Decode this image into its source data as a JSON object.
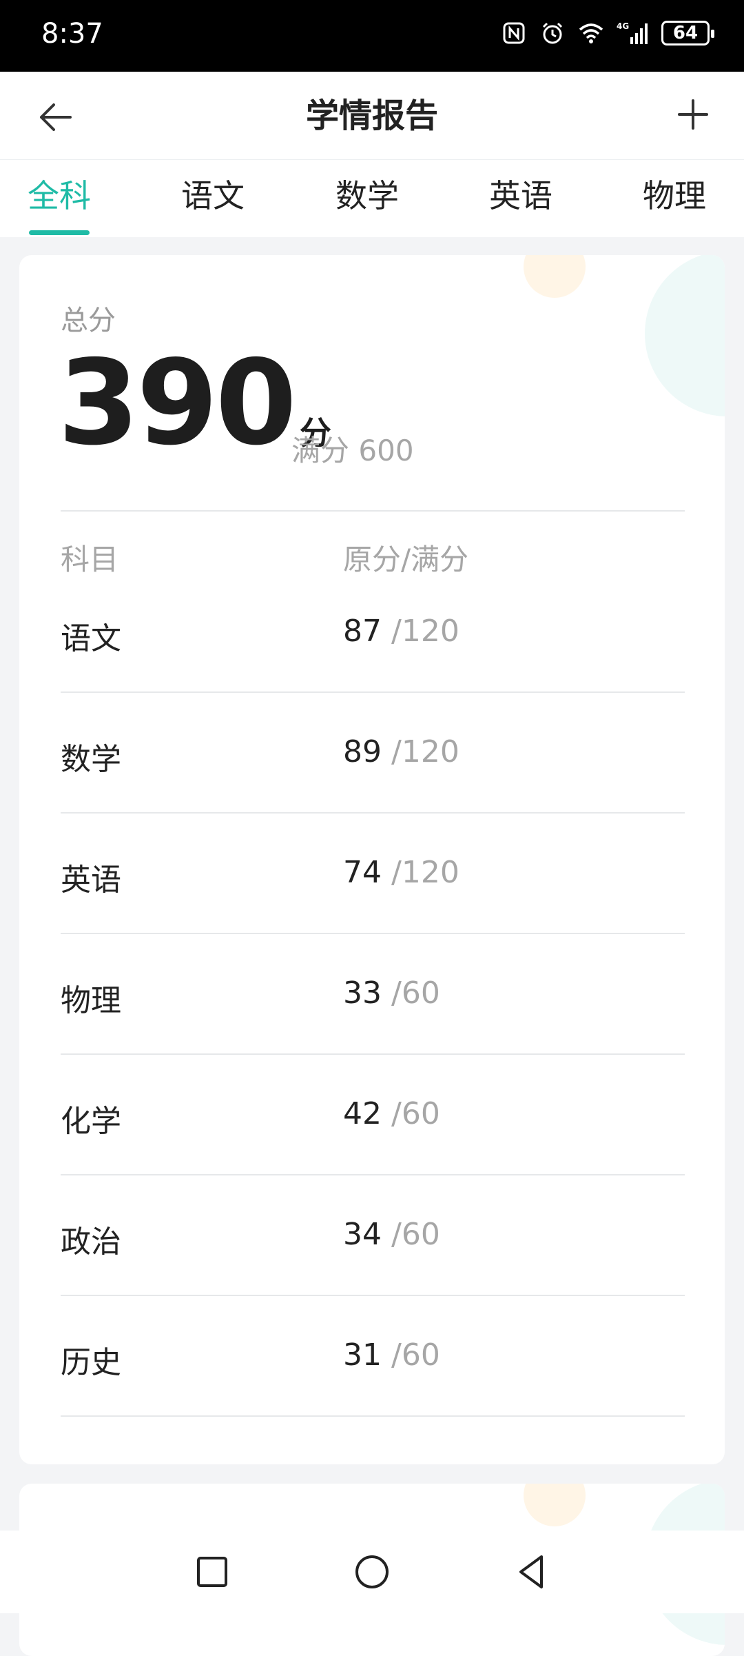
{
  "status_bar": {
    "time": "8:37",
    "battery": "64",
    "icons": [
      "nfc-icon",
      "alarm-icon",
      "wifi-icon",
      "signal-4g-icon",
      "battery-icon"
    ]
  },
  "header": {
    "title": "学情报告",
    "back_icon": "back-arrow-icon",
    "add_icon": "plus-icon"
  },
  "tabs": [
    {
      "label": "全科",
      "active": true
    },
    {
      "label": "语文",
      "active": false
    },
    {
      "label": "数学",
      "active": false
    },
    {
      "label": "英语",
      "active": false
    },
    {
      "label": "物理",
      "active": false
    }
  ],
  "summary": {
    "total_label": "总分",
    "total_value": "390",
    "total_unit": "分",
    "full_label": "满分",
    "full_value": "600"
  },
  "table": {
    "col_subject": "科目",
    "col_score": "原分/满分",
    "rows": [
      {
        "subject": "语文",
        "score": "87",
        "max": "/120"
      },
      {
        "subject": "数学",
        "score": "89",
        "max": "/120"
      },
      {
        "subject": "英语",
        "score": "74",
        "max": "/120"
      },
      {
        "subject": "物理",
        "score": "33",
        "max": "/60"
      },
      {
        "subject": "化学",
        "score": "42",
        "max": "/60"
      },
      {
        "subject": "政治",
        "score": "34",
        "max": "/60"
      },
      {
        "subject": "历史",
        "score": "31",
        "max": "/60"
      }
    ]
  },
  "colors": {
    "accent": "#1fbba6",
    "muted_text": "#a6a6a6",
    "page_background": "#f3f4f6"
  },
  "system_nav": [
    "recent-apps-icon",
    "home-icon",
    "back-icon"
  ]
}
